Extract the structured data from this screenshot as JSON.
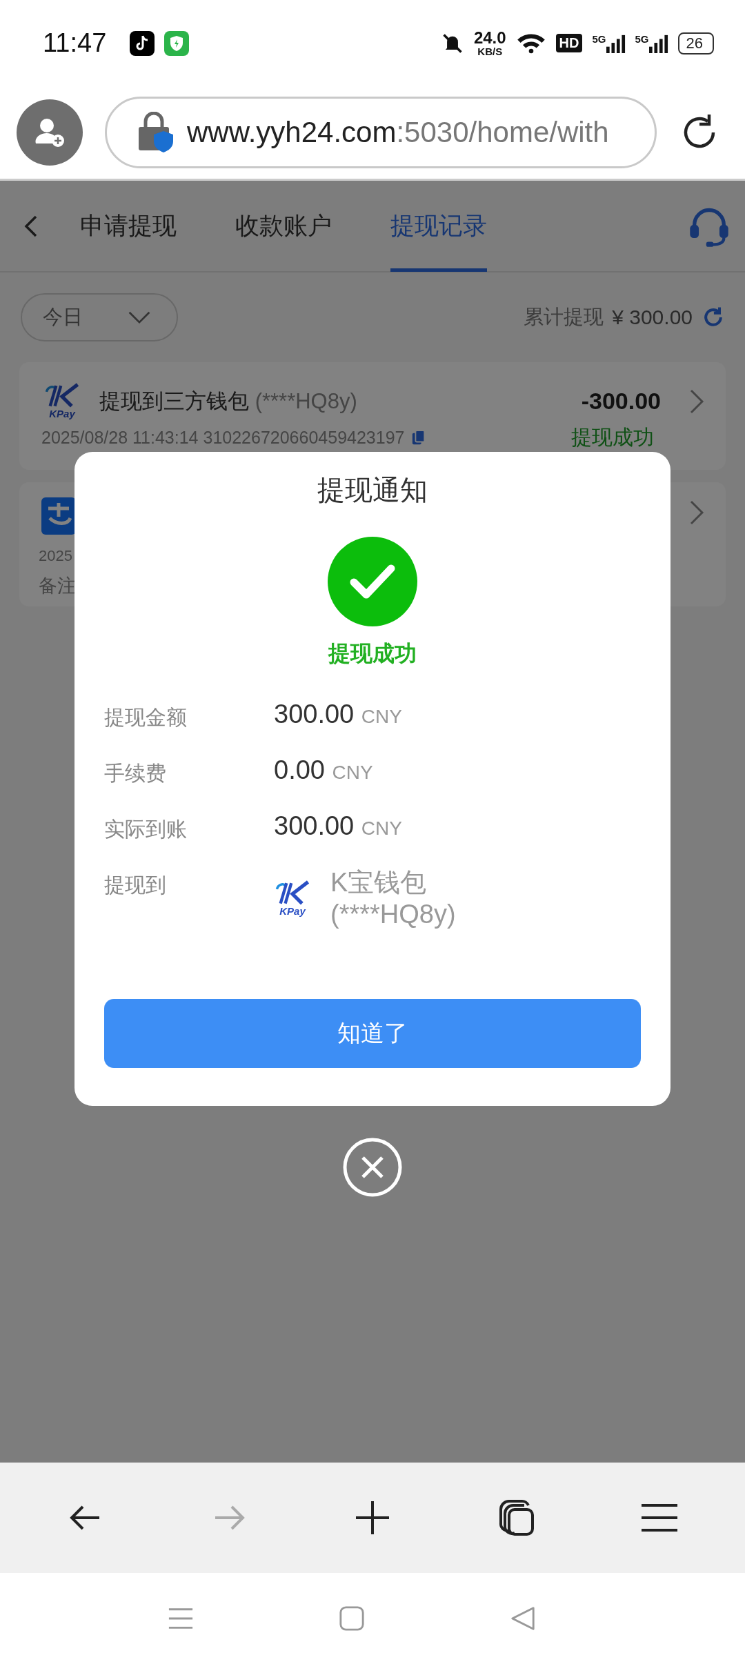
{
  "status_bar": {
    "time": "11:47",
    "net_speed": "24.0",
    "net_unit": "KB/S",
    "hd": "HD",
    "sim1": "5G",
    "sim2": "5G",
    "battery": "26"
  },
  "address_bar": {
    "host": "www.yyh24.com",
    "path": ":5030/home/with"
  },
  "tabs": [
    {
      "label": "申请提现",
      "selected": false
    },
    {
      "label": "收款账户",
      "selected": false
    },
    {
      "label": "提现记录",
      "selected": true
    }
  ],
  "filter": {
    "period": "今日",
    "total_label": "累计提现",
    "total": "¥ 300.00"
  },
  "records": [
    {
      "kind": "kpay",
      "logo": "KPay",
      "title": "提现到三方钱包",
      "account": "(****HQ8y)",
      "time": "2025/08/28 11:43:14",
      "order": "310226720660459423197",
      "amount": "-300.00",
      "status": "提现成功"
    },
    {
      "kind": "alipay",
      "time": "2025",
      "note": "备注"
    }
  ],
  "dialog": {
    "title": "提现通知",
    "result": "提现成功",
    "rows": [
      {
        "kind": "amount",
        "label": "提现金额",
        "value": "300.00",
        "unit": "CNY"
      },
      {
        "kind": "amount",
        "label": "手续费",
        "value": "0.00",
        "unit": "CNY"
      },
      {
        "kind": "amount",
        "label": "实际到账",
        "value": "300.00",
        "unit": "CNY"
      },
      {
        "kind": "account",
        "label": "提现到",
        "logo": "KPay",
        "name": "K宝钱包",
        "account": "(****HQ8y)"
      }
    ],
    "button": "知道了"
  },
  "toolbar": [
    {
      "kind": "back",
      "disabled": false
    },
    {
      "kind": "forward",
      "disabled": true
    },
    {
      "kind": "new-tab",
      "disabled": false
    },
    {
      "kind": "tabs",
      "disabled": false
    },
    {
      "kind": "menu",
      "disabled": false
    }
  ]
}
